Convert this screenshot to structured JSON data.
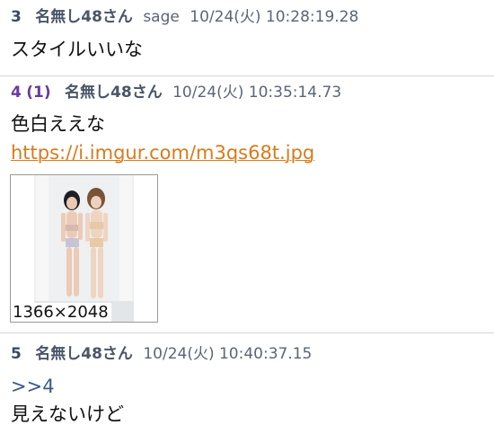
{
  "posts": [
    {
      "number": "3",
      "name": "名無し48さん",
      "mail": "sage",
      "date": "10/24(火) 10:28:19.28",
      "body": "スタイルいいな"
    },
    {
      "number": "4",
      "reply_count": "(1)",
      "name": "名無し48さん",
      "date": "10/24(火) 10:35:14.73",
      "body": "色白ええな",
      "link": "https://i.imgur.com/m3qs68t.jpg",
      "image_resolution": "1366×2048"
    },
    {
      "number": "5",
      "name": "名無し48さん",
      "date": "10/24(火) 10:40:37.15",
      "anchor": ">>4",
      "body": "見えないけど"
    }
  ],
  "colors": {
    "link": "#d97a1a",
    "reply_number": "#6a3aa0",
    "header_text": "#5a6577",
    "anchor": "#3a5a8a"
  }
}
